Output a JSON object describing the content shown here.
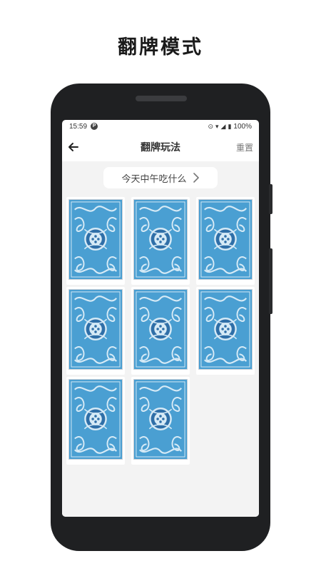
{
  "promo": {
    "title": "翻牌模式"
  },
  "status_bar": {
    "time": "15:59",
    "battery": "100%"
  },
  "app_bar": {
    "title": "翻牌玩法",
    "reset_label": "重置"
  },
  "question": {
    "text": "今天中午吃什么"
  },
  "cards": [
    {
      "state": "face-down"
    },
    {
      "state": "face-down"
    },
    {
      "state": "face-down"
    },
    {
      "state": "face-down"
    },
    {
      "state": "face-down"
    },
    {
      "state": "face-down"
    },
    {
      "state": "face-down"
    },
    {
      "state": "face-down"
    }
  ],
  "colors": {
    "card_blue": "#4a9fd2",
    "card_dark": "#2f6fa8",
    "card_light": "#d6eaf6",
    "background": "#f3f3f3"
  },
  "icons": {
    "back": "arrow-left-icon",
    "chevron": "chevron-right-icon"
  }
}
